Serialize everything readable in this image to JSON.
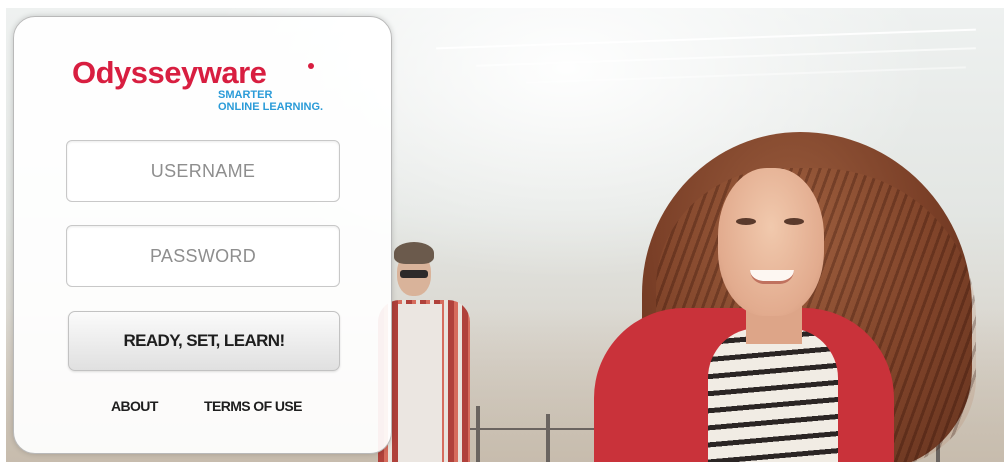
{
  "brand": {
    "name": "Odysseyware",
    "tagline_line1": "SMARTER",
    "tagline_line2": "ONLINE LEARNING.",
    "primary_color": "#d81e40",
    "tagline_color": "#2a9bd8"
  },
  "login": {
    "username_placeholder": "USERNAME",
    "username_value": "",
    "password_placeholder": "PASSWORD",
    "password_value": "",
    "submit_label": "READY, SET, LEARN!"
  },
  "footer": {
    "about_label": "ABOUT",
    "terms_label": "TERMS OF USE"
  }
}
